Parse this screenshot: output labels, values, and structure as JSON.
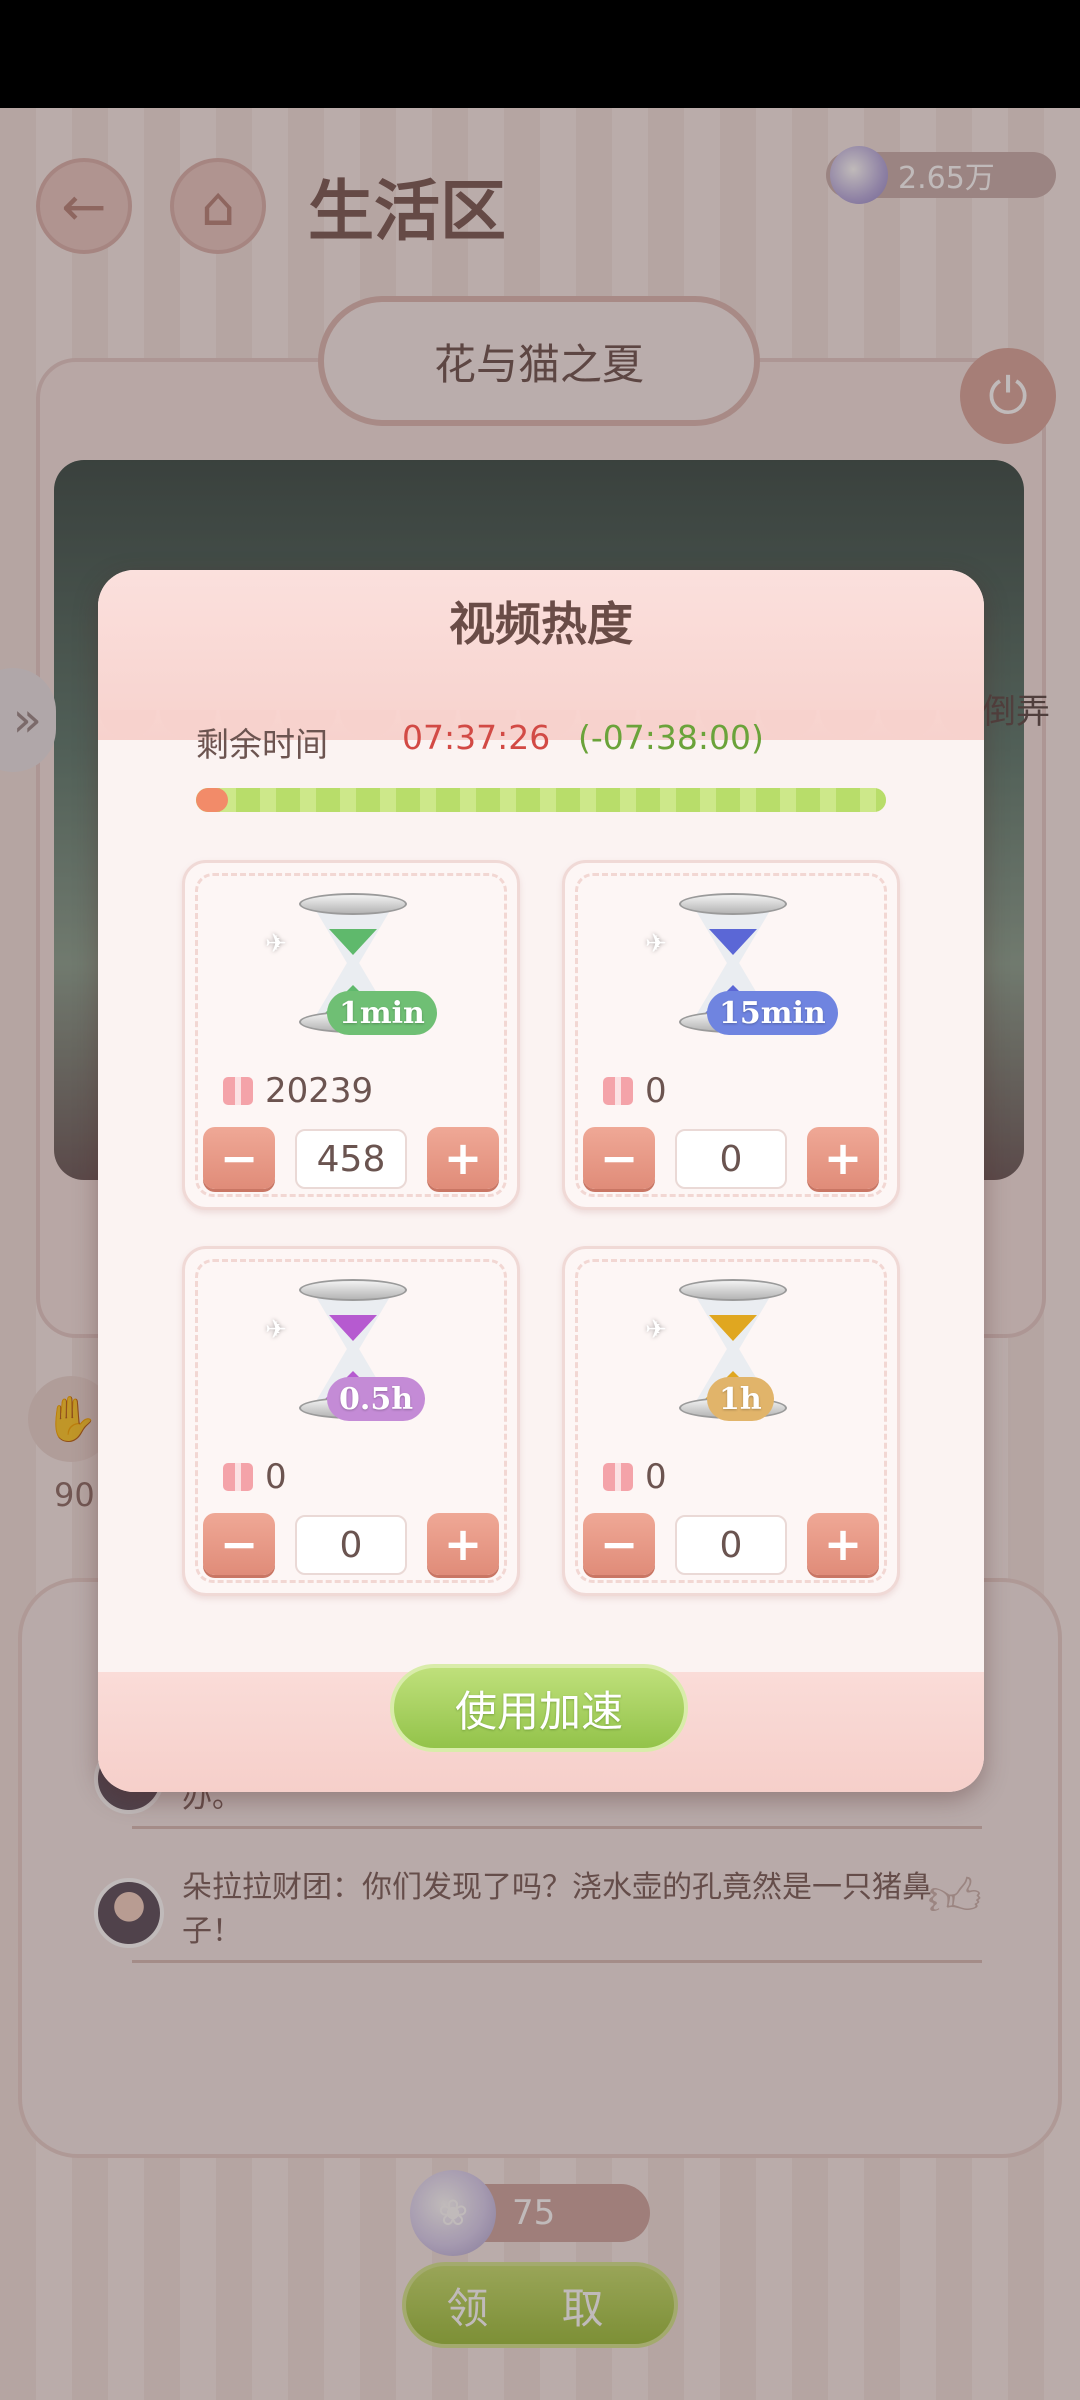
{
  "background": {
    "title": "生活区",
    "currency": "2.65万",
    "banner_title": "花与猫之夏",
    "side_text": "倒弄",
    "like_count": "90",
    "comments": [
      {
        "text": "菲力克：浇完花要记得清理一下地面，万一有人滑倒怎么办。"
      },
      {
        "text": "朵拉拉财团：你们发现了吗？浇水壶的孔竟然是一只猪鼻子！"
      }
    ],
    "bottom_counter": "75",
    "claim_label": "领 取"
  },
  "modal": {
    "title": "视频热度",
    "time_label": "剩余时间",
    "time_value": "07:37:26",
    "time_delta": "(-07:38:00)",
    "progress_fraction": 1.0,
    "items": [
      {
        "tag": "1min",
        "owned": "20239",
        "quantity": "458",
        "sand_color": "#5fb96c",
        "tag_color": "#6fbf74"
      },
      {
        "tag": "15min",
        "owned": "0",
        "quantity": "0",
        "sand_color": "#5b67d6",
        "tag_color": "#6f84e0"
      },
      {
        "tag": "0.5h",
        "owned": "0",
        "quantity": "0",
        "sand_color": "#b65ad0",
        "tag_color": "#c48bd6"
      },
      {
        "tag": "1h",
        "owned": "0",
        "quantity": "0",
        "sand_color": "#e0a720",
        "tag_color": "#e1b46a"
      }
    ],
    "minus_label": "−",
    "plus_label": "+",
    "use_button": "使用加速"
  },
  "icons": {
    "back": "back-arrow-icon",
    "home": "home-icon",
    "power": "power-icon",
    "like": "thumbs-up-icon",
    "gift": "gift-icon",
    "speed": "drone-speed-icon"
  }
}
